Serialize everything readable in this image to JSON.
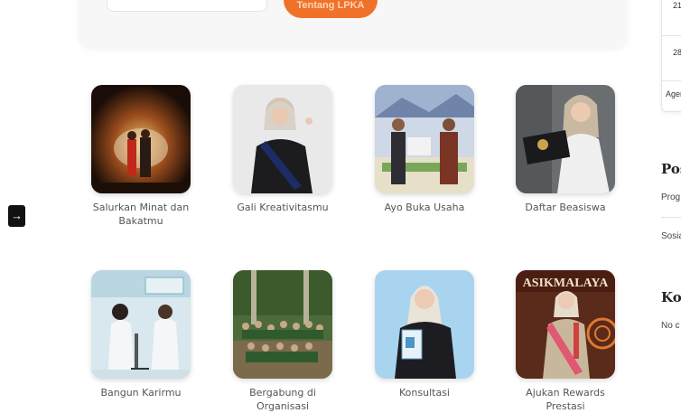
{
  "top": {
    "button_label": "Tentang LPKA"
  },
  "side_button": {
    "icon": "arrow-right-icon",
    "glyph": "→"
  },
  "tiles": [
    {
      "label": "Salurkan Minat dan Bakatmu",
      "icon": "stage-performance-image"
    },
    {
      "label": "Gali Kreativitasmu",
      "icon": "ambassador-portrait-image"
    },
    {
      "label": "Ayo Buka Usaha",
      "icon": "award-ceremony-image"
    },
    {
      "label": "Daftar Beasiswa",
      "icon": "scholarship-portrait-image"
    },
    {
      "label": "Bangun Karirmu",
      "icon": "laboratory-image"
    },
    {
      "label": "Bergabung di Organisasi",
      "icon": "group-photo-image"
    },
    {
      "label": "Konsultasi",
      "icon": "consultation-portrait-image"
    },
    {
      "label": "Ajukan Rewards Prestasi",
      "icon": "pageant-portrait-image"
    }
  ],
  "sidebar": {
    "calendar": {
      "day1": "21",
      "day2": "28",
      "agenda": "Agen"
    },
    "posts_heading": "Pos",
    "posts": [
      "Prog",
      "Sosia"
    ],
    "comments_heading": "Kor",
    "comments_text": "No c"
  }
}
